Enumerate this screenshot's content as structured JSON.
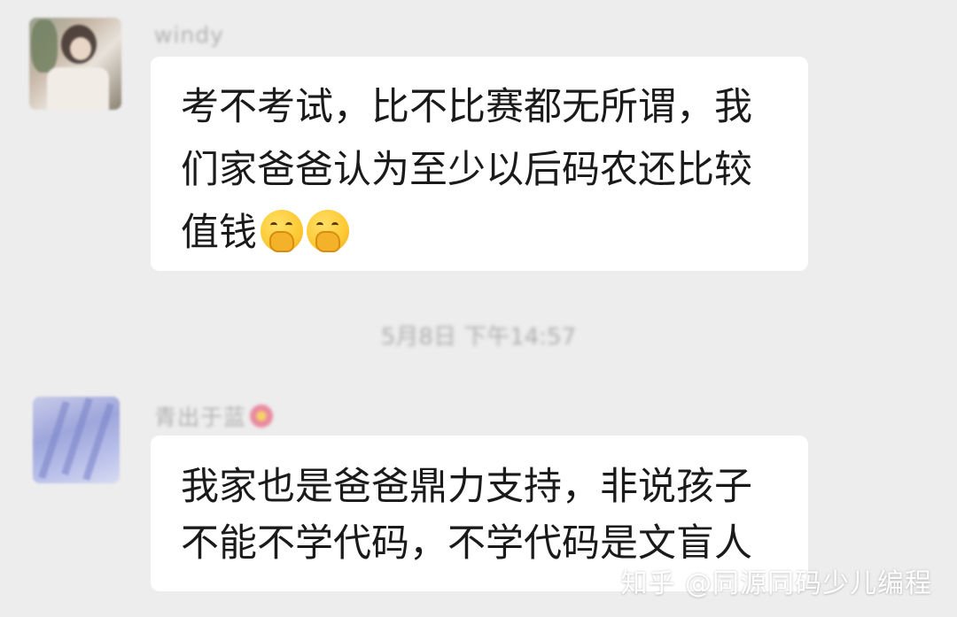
{
  "messages": [
    {
      "sender": "windy",
      "lines": [
        "考不考试，比不比赛都无所谓，我",
        "们家爸爸认为至少以后码农还比较",
        "值钱"
      ],
      "emojis": [
        "hand-over-mouth-emoji",
        "hand-over-mouth-emoji"
      ]
    },
    {
      "sender": "青出于蓝",
      "lines": [
        "我家也是爸爸鼎力支持，非说孩子",
        "不能不学代码，不学代码是文盲人"
      ]
    }
  ],
  "timestamp": "5月8日 下午14:57",
  "watermark": "知乎 @同源同码少儿编程",
  "colors": {
    "background": "#ededed",
    "bubble": "#ffffff",
    "text": "#1a1a1a",
    "meta_text": "#b2b2b2"
  }
}
